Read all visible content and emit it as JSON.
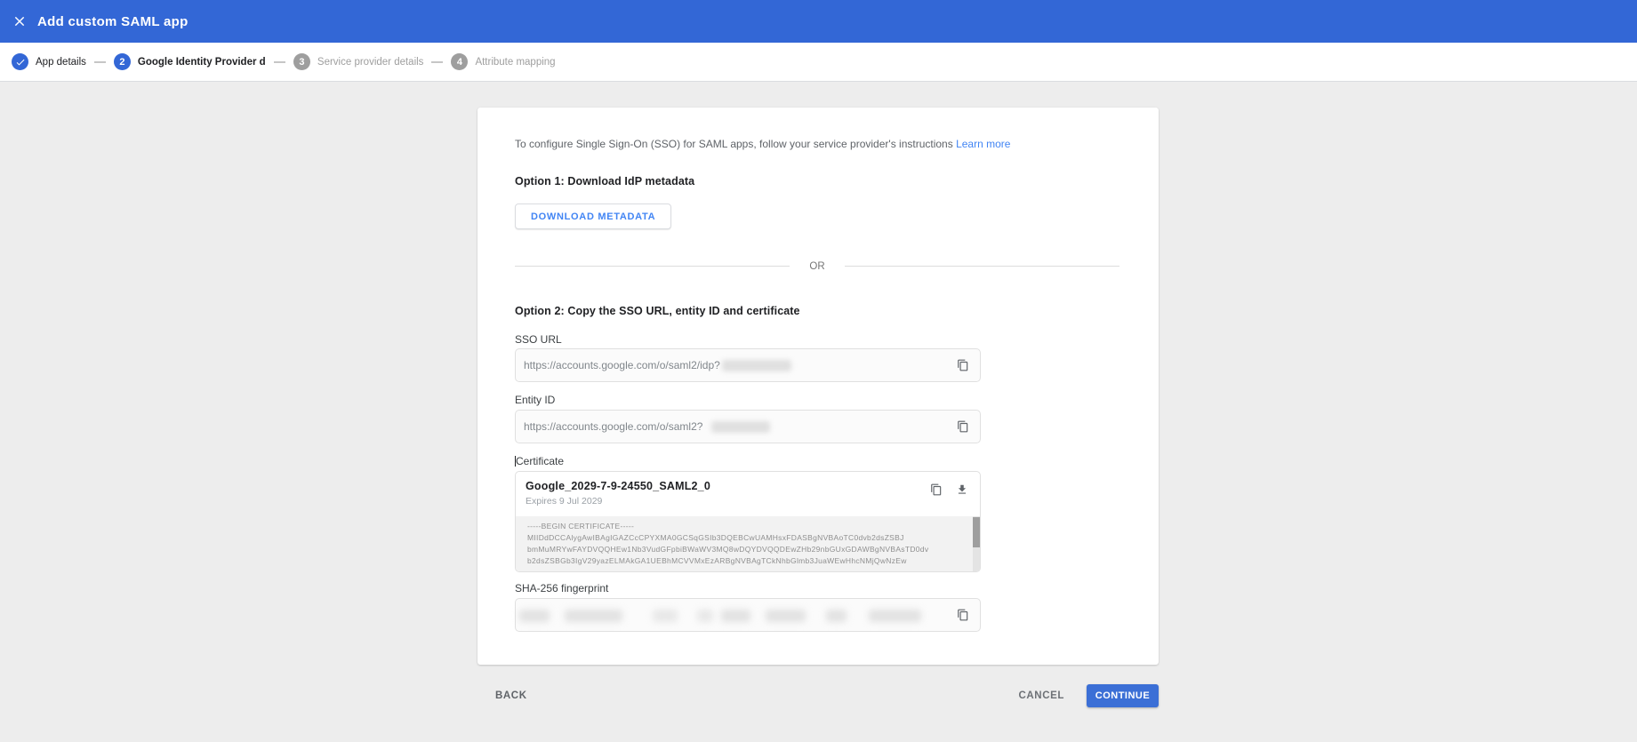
{
  "app_bar": {
    "title": "Add custom SAML app"
  },
  "stepper": {
    "steps": [
      {
        "number": "1",
        "label": "App details",
        "state": "completed"
      },
      {
        "number": "2",
        "label": "Google Identity Provider details",
        "state": "active"
      },
      {
        "number": "3",
        "label": "Service provider details",
        "state": "upcoming"
      },
      {
        "number": "4",
        "label": "Attribute mapping",
        "state": "upcoming"
      }
    ]
  },
  "content": {
    "intro": "To configure Single Sign-On (SSO) for SAML apps, follow your service provider's instructions ",
    "learn_more": "Learn more",
    "option1_heading": "Option 1: Download IdP metadata",
    "download_button": "DOWNLOAD METADATA",
    "or_label": "OR",
    "option2_heading": "Option 2: Copy the SSO URL, entity ID and certificate",
    "sso_url_label": "SSO URL",
    "sso_url_value": "https://accounts.google.com/o/saml2/idp?",
    "entity_id_label": "Entity ID",
    "entity_id_value": "https://accounts.google.com/o/saml2?",
    "certificate_label": "Certificate",
    "certificate_name": "Google_2029-7-9-24550_SAML2_0",
    "certificate_expiry": "Expires 9 Jul 2029",
    "certificate_lines": [
      "-----BEGIN CERTIFICATE-----",
      "MIIDdDCCAlygAwIBAgIGAZCcCPYXMA0GCSqGSIb3DQEBCwUAMHsxFDASBgNVBAoTC0dvb2dsZSBJ",
      "bmMuMRYwFAYDVQQHEw1Nb3VudGFpbiBWaWV3MQ8wDQYDVQQDEwZHb29nbGUxGDAWBgNVBAsTD0dv",
      "b2dsZSBGb3IgV29yazELMAkGA1UEBhMCVVMxEzARBgNVBAgTCkNhbGlmb3JuaWEwHhcNMjQwNzEw"
    ],
    "sha256_label": "SHA-256 fingerprint"
  },
  "footer": {
    "back": "BACK",
    "cancel": "CANCEL",
    "continue": "CONTINUE"
  },
  "colors": {
    "app_bar_blue": "#3367d6",
    "link_blue": "#4285f4",
    "continue_blue": "#3b6fd6",
    "inactive_step_gray": "#9e9e9e"
  }
}
